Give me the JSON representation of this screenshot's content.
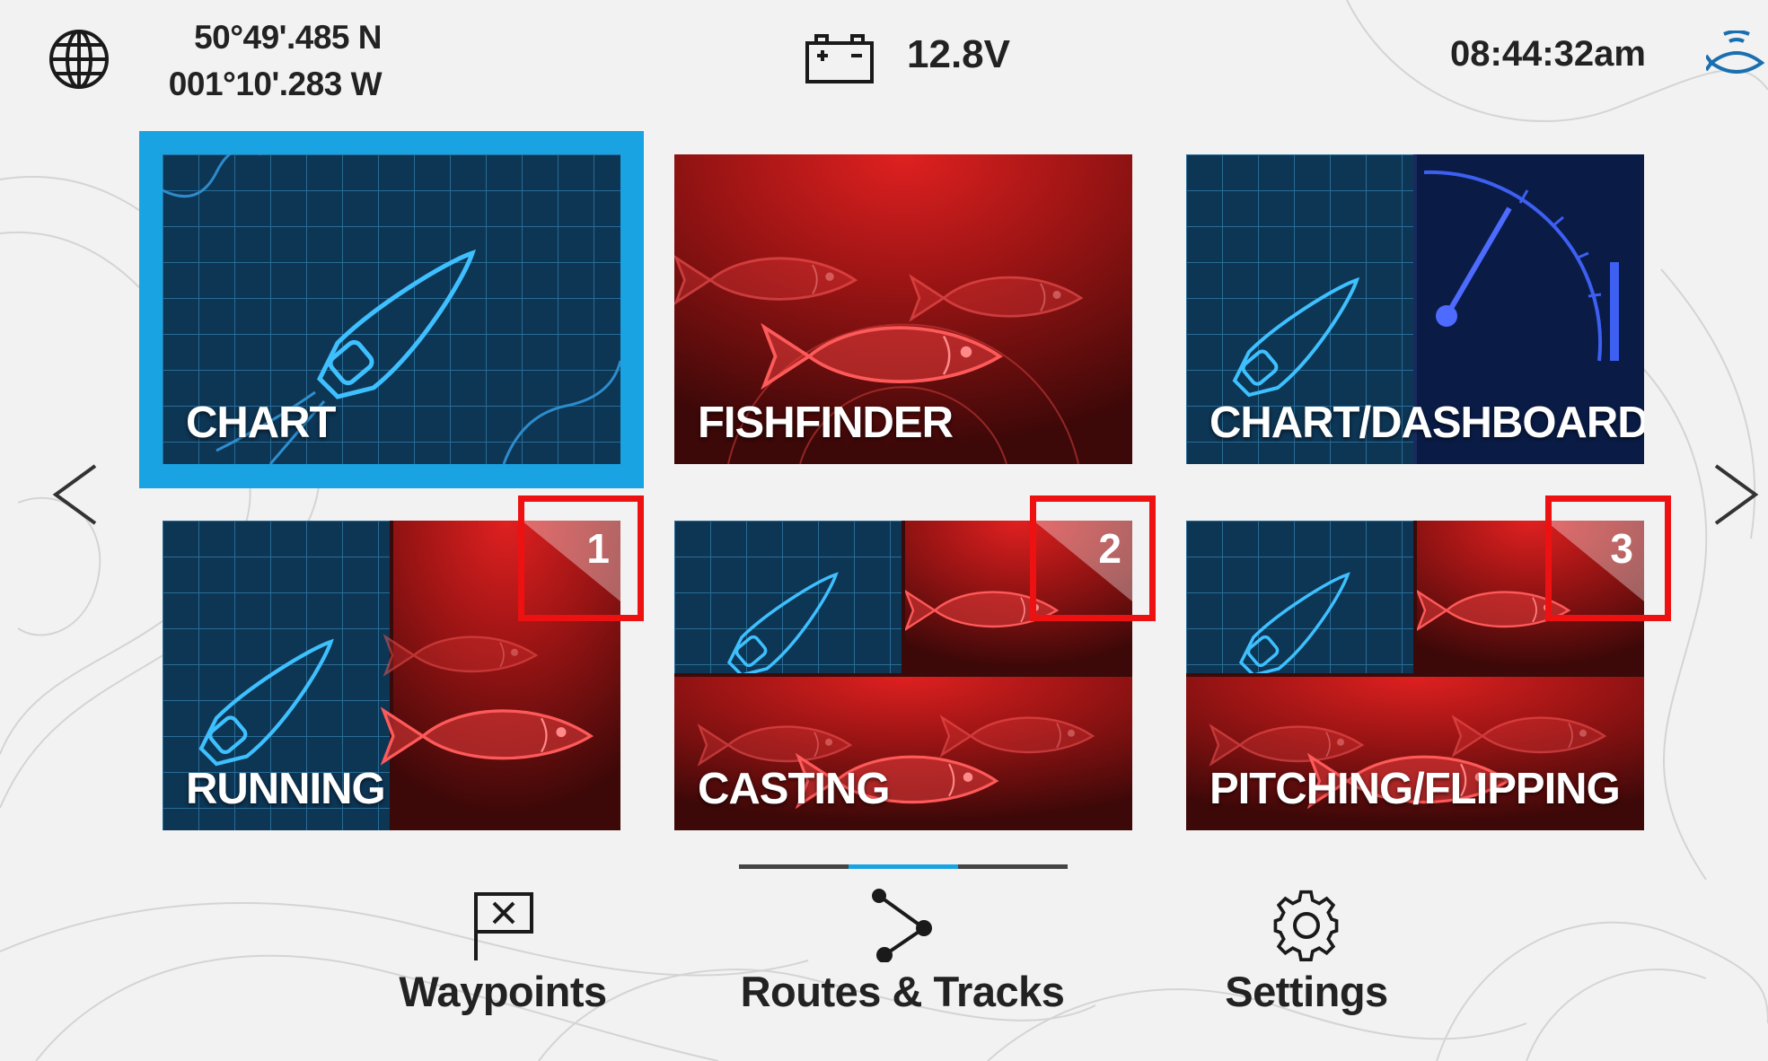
{
  "status": {
    "latitude": "50°49'.485 N",
    "longitude": "001°10'.283 W",
    "voltage": "12.8V",
    "time": "08:44:32am"
  },
  "tiles": [
    {
      "label": "CHART",
      "selected": true
    },
    {
      "label": "FISHFINDER"
    },
    {
      "label": "CHART/DASHBOARD"
    },
    {
      "label": "RUNNING",
      "badge": "1"
    },
    {
      "label": "CASTING",
      "badge": "2"
    },
    {
      "label": "PITCHING/FLIPPING",
      "badge": "3"
    }
  ],
  "pagination": {
    "pages": 3,
    "current": 2
  },
  "bottom_nav": [
    {
      "label": "Waypoints",
      "icon": "waypoint-flag-icon"
    },
    {
      "label": "Routes & Tracks",
      "icon": "route-icon"
    },
    {
      "label": "Settings",
      "icon": "gear-icon"
    }
  ],
  "colors": {
    "accent": "#1aa3e3",
    "chart_bg": "#0d3554",
    "sonar_bg": "#5a0d0d",
    "highlight": "#ee1111"
  }
}
